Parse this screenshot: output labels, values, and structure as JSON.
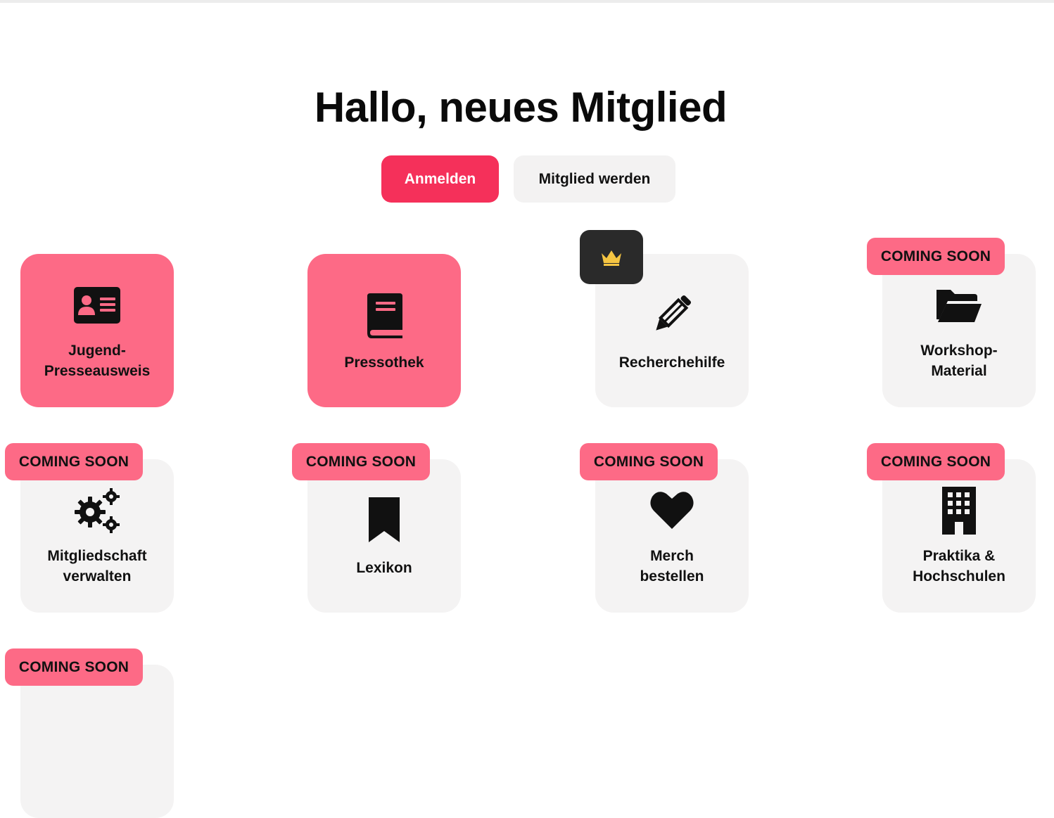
{
  "page": {
    "title": "Hallo, neues Mitglied"
  },
  "actions": {
    "login_label": "Anmelden",
    "join_label": "Mitglied werden"
  },
  "colors": {
    "accent": "#f5305a",
    "tile_active": "#fd6a86",
    "tile_inactive": "#f4f3f3",
    "premium_badge": "#2a2a2a",
    "crown": "#f5c542"
  },
  "badges": {
    "coming_soon": "COMING SOON",
    "premium_icon": "crown-icon"
  },
  "tiles": [
    {
      "label": "Jugend-\nPresseausweis",
      "icon": "id-card-icon",
      "active": true,
      "badge": ""
    },
    {
      "label": "Pressothek",
      "icon": "book-icon",
      "active": true,
      "badge": ""
    },
    {
      "label": "Recherchehilfe",
      "icon": "pencil-icon",
      "active": false,
      "badge": "premium"
    },
    {
      "label": "Workshop-\nMaterial",
      "icon": "folder-open-icon",
      "active": false,
      "badge": "COMING SOON"
    },
    {
      "label": "Mitgliedschaft\nverwalten",
      "icon": "gears-icon",
      "active": false,
      "badge": "COMING SOON"
    },
    {
      "label": "Lexikon",
      "icon": "bookmark-icon",
      "active": false,
      "badge": "COMING SOON"
    },
    {
      "label": "Merch\nbestellen",
      "icon": "heart-icon",
      "active": false,
      "badge": "COMING SOON"
    },
    {
      "label": "Praktika &\nHochschulen",
      "icon": "building-icon",
      "active": false,
      "badge": "COMING SOON"
    },
    {
      "label": "",
      "icon": "",
      "active": false,
      "badge": "COMING SOON"
    }
  ]
}
